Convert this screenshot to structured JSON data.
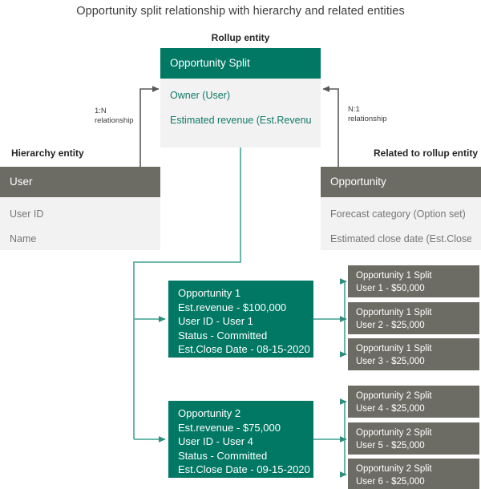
{
  "title": "Opportunity split relationship with hierarchy and related entities",
  "colors": {
    "green": "#017864",
    "gray": "#6d6c64",
    "light_gray_body": "#f2f2f2",
    "teal_connector": "#5aada0",
    "dark_connector": "#585858",
    "field_teal_text": "#0f7a68",
    "field_gray_text": "#767676"
  },
  "labels": {
    "rollup_section": "Rollup entity",
    "hierarchy_section": "Hierarchy entity",
    "related_section": "Related to rollup entity"
  },
  "entities": {
    "rollup": {
      "name": "Opportunity Split",
      "fields": [
        "Owner (User)",
        "Estimated revenue (Est.Revenue)"
      ]
    },
    "hierarchy": {
      "name": "User",
      "fields": [
        "User ID",
        "Name"
      ]
    },
    "related": {
      "name": "Opportunity",
      "fields": [
        "Forecast category (Option set)",
        "Estimated close date (Est.Close Date)"
      ]
    }
  },
  "relationships": {
    "left": {
      "cardinality": "1:N",
      "text": "relationship"
    },
    "right": {
      "cardinality": "N:1",
      "text": "relationship"
    }
  },
  "opportunities": [
    {
      "id": "opportunity-1",
      "lines": [
        "Opportunity 1",
        "Est.revenue - $100,000",
        "User ID - User 1",
        "Status - Committed",
        "Est.Close Date - 08-15-2020"
      ],
      "splits": [
        {
          "title": "Opportunity 1 Split",
          "detail": "User 1 - $50,000"
        },
        {
          "title": "Opportunity 1 Split",
          "detail": "User 2 - $25,000"
        },
        {
          "title": "Opportunity 1 Split",
          "detail": "User 3 - $25,000"
        }
      ]
    },
    {
      "id": "opportunity-2",
      "lines": [
        "Opportunity 2",
        "Est.revenue - $75,000",
        "User ID - User 4",
        "Status - Committed",
        "Est.Close Date - 09-15-2020"
      ],
      "splits": [
        {
          "title": "Opportunity 2 Split",
          "detail": "User 4 - $25,000"
        },
        {
          "title": "Opportunity 2 Split",
          "detail": "User 5 - $25,000"
        },
        {
          "title": "Opportunity 2 Split",
          "detail": "User 6 - $25,000"
        }
      ]
    }
  ]
}
